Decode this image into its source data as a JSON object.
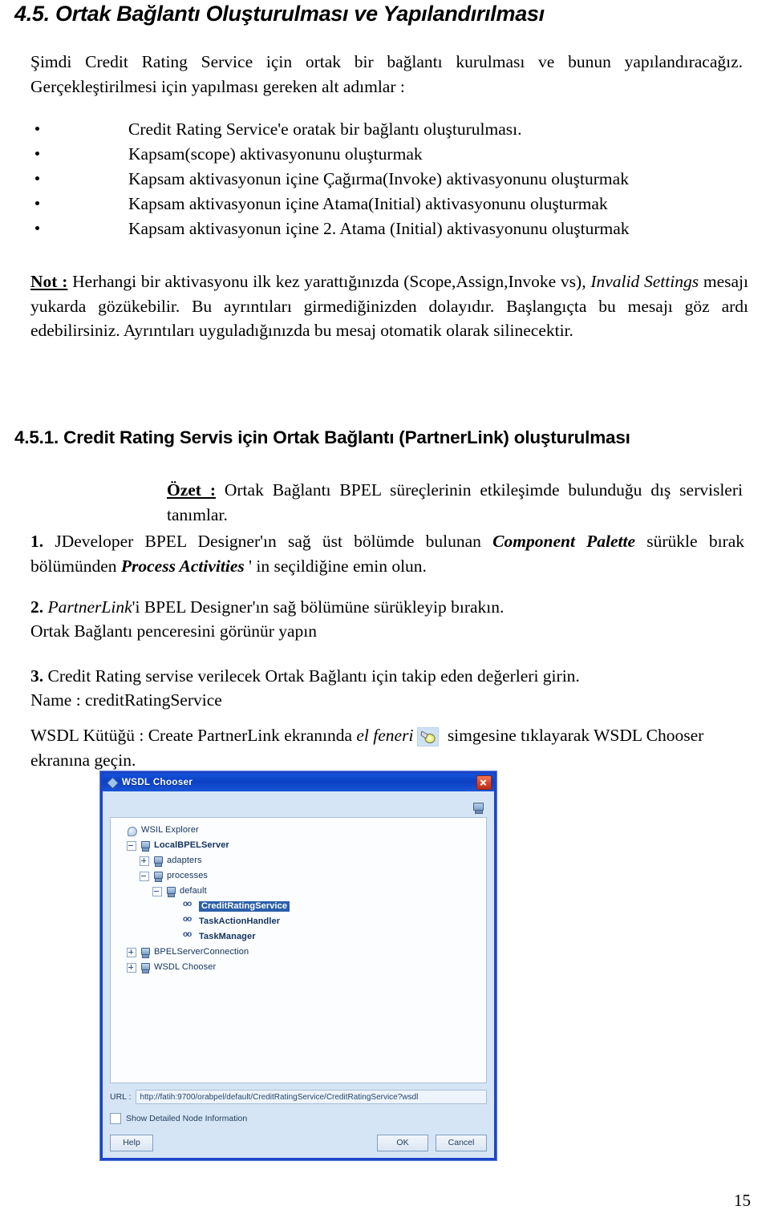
{
  "document": {
    "heading_main": "4.5. Ortak Bağlantı Oluşturulması ve Yapılandırılması",
    "heading_sub": "4.5.1. Credit Rating Servis için Ortak Bağlantı (PartnerLink) oluşturulması",
    "page_number": "15"
  },
  "intro": {
    "text": "Şimdi Credit Rating Service için ortak bir bağlantı kurulması ve bunun yapılandıracağız. Gerçekleştirilmesi için yapılması gereken alt adımlar :"
  },
  "bullets": [
    {
      "text": "Credit Rating Service'e oratak bir bağlantı oluşturulması."
    },
    {
      "text": "Kapsam(scope) aktivasyonunu oluşturmak"
    },
    {
      "text": "Kapsam aktivasyonun içine Çağırma(Invoke) aktivasyonunu oluşturmak"
    },
    {
      "text": "Kapsam aktivasyonun içine Atama(Initial) aktivasyonunu oluşturmak"
    },
    {
      "text": "Kapsam aktivasyonun içine 2. Atama (Initial) aktivasyonunu oluşturmak"
    }
  ],
  "note": {
    "label": "Not :",
    "part1": " Herhangi bir aktivasyonu ilk kez yarattığınızda (Scope,Assign,Invoke vs), ",
    "emphasis": "Invalid Settings",
    "part2": " mesajı yukarda gözükebilir. Bu ayrıntıları girmediğinizden dolayıdır. Başlangıçta bu mesajı göz ardı edebilirsiniz. Ayrıntıları uyguladığınızda bu mesaj otomatik olarak silinecektir."
  },
  "summary": {
    "label": "Özet :",
    "text": " Ortak Bağlantı BPEL süreçlerinin etkileşimde bulunduğu dış servisleri tanımlar."
  },
  "steps": {
    "step1_num": "1.",
    "step1_a": " JDeveloper BPEL Designer'ın sağ üst bölümde bulunan ",
    "step1_em1": "Component Palette",
    "step1_b": " sürükle bırak bölümünden ",
    "step1_em2": "Process Activities",
    "step1_c": " ' in seçildiğine emin olun.",
    "step2_num": "2.",
    "step2_em": "PartnerLink",
    "step2_a": "'i BPEL Designer'ın sağ bölümüne sürükleyip bırakın.",
    "step2_line2": "Ortak Bağlantı penceresini görünür yapın",
    "step3_num": "3.",
    "step3_a": " Credit Rating servise verilecek  Ortak Bağlantı için takip eden değerleri girin.",
    "step3_name": "Name : creditRatingService",
    "wsdl_a": "WSDL Kütüğü : Create PartnerLink ekranında ",
    "wsdl_em": "el feneri",
    "wsdl_b": " simgesine tıklayarak WSDL Chooser ekranına geçin."
  },
  "dialog": {
    "title": "WSDL Chooser",
    "tree": [
      {
        "label": "WSIL Explorer",
        "indent": 0,
        "expander": "none",
        "icon": "explorer-icon",
        "selected": false,
        "bold": false
      },
      {
        "label": "LocalBPELServer",
        "indent": 1,
        "expander": "minus",
        "icon": "server-icon",
        "selected": false,
        "bold": true
      },
      {
        "label": "adapters",
        "indent": 2,
        "expander": "plus",
        "icon": "server-icon",
        "selected": false,
        "bold": false
      },
      {
        "label": "processes",
        "indent": 2,
        "expander": "minus",
        "icon": "server-icon",
        "selected": false,
        "bold": false
      },
      {
        "label": "default",
        "indent": 3,
        "expander": "minus",
        "icon": "server-icon",
        "selected": false,
        "bold": false
      },
      {
        "label": "CreditRatingService",
        "indent": 4,
        "expander": "none",
        "icon": "wsdl-icon",
        "selected": true,
        "bold": true
      },
      {
        "label": "TaskActionHandler",
        "indent": 4,
        "expander": "none",
        "icon": "wsdl-icon",
        "selected": false,
        "bold": true
      },
      {
        "label": "TaskManager",
        "indent": 4,
        "expander": "none",
        "icon": "wsdl-icon",
        "selected": false,
        "bold": true
      },
      {
        "label": "BPELServerConnection",
        "indent": 1,
        "expander": "plus",
        "icon": "server-icon",
        "selected": false,
        "bold": false
      },
      {
        "label": "WSDL Chooser",
        "indent": 1,
        "expander": "plus",
        "icon": "server-icon",
        "selected": false,
        "bold": false
      }
    ],
    "url_label": "URL :",
    "url_value": "http://fatih:9700/orabpel/default/CreditRatingService/CreditRatingService?wsdl",
    "checkbox_label": "Show Detailed Node Information",
    "checkbox_checked": false,
    "buttons": {
      "help": "Help",
      "ok": "OK",
      "cancel": "Cancel"
    }
  },
  "colors": {
    "dialog_border": "#1b45c8",
    "titlebar": "#0b3fc4",
    "selection": "#2b5fa8",
    "dialog_face": "#d6e5f5"
  }
}
